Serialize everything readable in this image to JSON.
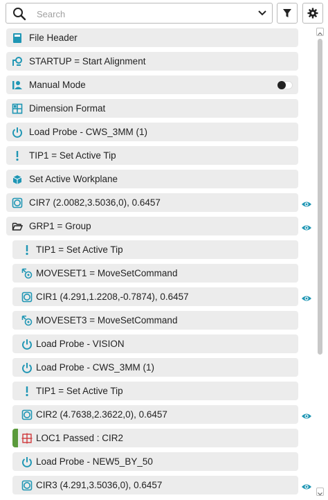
{
  "search": {
    "placeholder": "Search",
    "value": ""
  },
  "toolbar": {
    "filter_icon": "filter-icon",
    "settings_icon": "gear-icon"
  },
  "colors": {
    "accent": "#1f96b4",
    "pass_marker": "#5b9a3c",
    "loc_icon": "#d0393b",
    "row_bg": "#ececec"
  },
  "items": [
    {
      "label": "File Header",
      "icon": "file-header-icon"
    },
    {
      "label": "STARTUP = Start Alignment",
      "icon": "alignment-icon"
    },
    {
      "label": "Manual Mode",
      "icon": "manual-mode-icon",
      "toggle_on": false
    },
    {
      "label": "Dimension Format",
      "icon": "dimension-format-icon"
    },
    {
      "label": "Load Probe - CWS_3MM (1)",
      "icon": "probe-icon"
    },
    {
      "label": "TIP1 = Set Active Tip",
      "icon": "tip-icon"
    },
    {
      "label": "Set Active Workplane",
      "icon": "workplane-icon"
    },
    {
      "label": "CIR7 (2.0082,3.5036,0), 0.6457",
      "icon": "circle-feature-icon",
      "visible": true
    },
    {
      "label": "GRP1 = Group",
      "icon": "folder-open-icon",
      "visible": true
    },
    {
      "label": "TIP1 = Set Active Tip",
      "icon": "tip-icon"
    },
    {
      "label": "MOVESET1 = MoveSetCommand",
      "icon": "moveset-icon"
    },
    {
      "label": "CIR1 (4.291,1.2208,-0.7874), 0.6457",
      "icon": "circle-feature-icon",
      "visible": true
    },
    {
      "label": "MOVESET3 = MoveSetCommand",
      "icon": "moveset-icon"
    },
    {
      "label": "Load Probe - VISION",
      "icon": "probe-icon"
    },
    {
      "label": "Load Probe - CWS_3MM (1)",
      "icon": "probe-icon"
    },
    {
      "label": "TIP1 = Set Active Tip",
      "icon": "tip-icon"
    },
    {
      "label": "CIR2 (4.7638,2.3622,0), 0.6457",
      "icon": "circle-feature-icon",
      "visible": true
    },
    {
      "label": "LOC1 Passed : CIR2",
      "icon": "location-icon",
      "passed": true
    },
    {
      "label": "Load Probe - NEW5_BY_50",
      "icon": "probe-icon"
    },
    {
      "label": "CIR3 (4.291,3.5036,0), 0.6457",
      "icon": "circle-feature-icon",
      "visible": true
    }
  ]
}
